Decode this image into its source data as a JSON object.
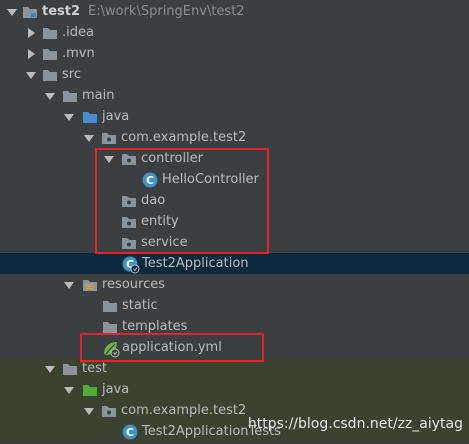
{
  "project": {
    "name": "test2",
    "path": "E:\\work\\SpringEnv\\test2"
  },
  "tree": {
    "idea": ".idea",
    "mvn": ".mvn",
    "src": "src",
    "main": "main",
    "java": "java",
    "package": "com.example.test2",
    "controller": "controller",
    "hello_controller": "HelloController",
    "dao": "dao",
    "entity": "entity",
    "service": "service",
    "app_class": "Test2Application",
    "resources": "resources",
    "static": "static",
    "templates": "templates",
    "app_yml": "application.yml",
    "test": "test",
    "test_java": "java",
    "test_package": "com.example.test2",
    "test_class": "Test2ApplicationTests"
  },
  "watermark": "https://blog.csdn.net/zz_aiytag",
  "colors": {
    "background": "#3c3f41",
    "selection": "#0d293e",
    "test_row": "#39432f",
    "highlight_box": "#e3242b",
    "folder": "#8a949a",
    "java_folder": "#4b8ccb",
    "test_folder": "#54a93a",
    "class_icon": "#3f93c4"
  }
}
